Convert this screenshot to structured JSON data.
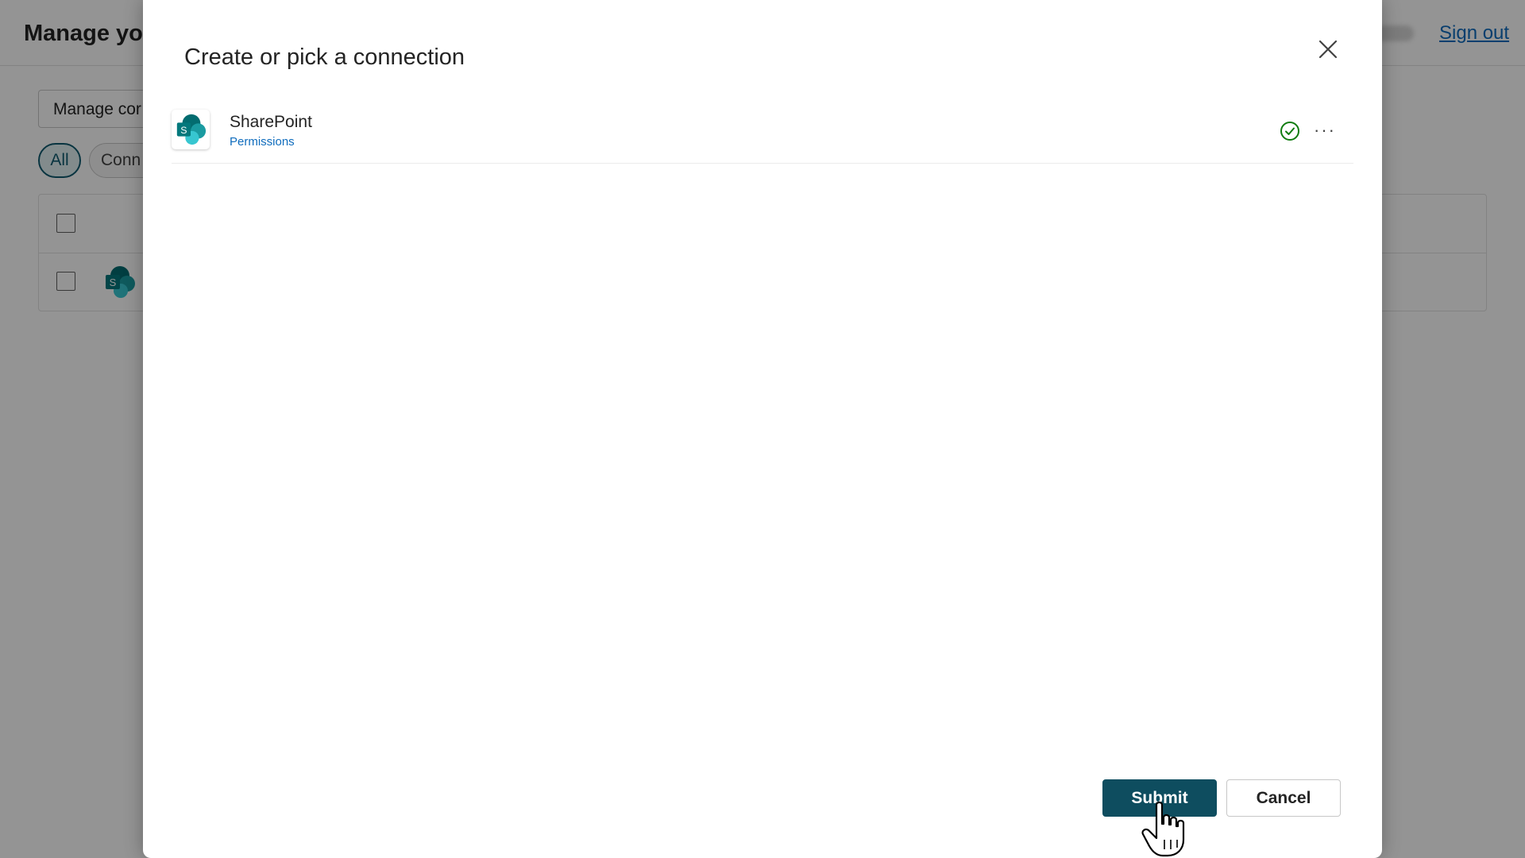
{
  "background": {
    "page_title": "Manage you",
    "sign_out": "Sign out",
    "manage_button_label": "Manage cor",
    "filter_all": "All",
    "filter_connections": "Conn"
  },
  "dialog": {
    "title": "Create or pick a connection",
    "connection": {
      "name": "SharePoint",
      "link_label": "Permissions",
      "icon": "sharepoint-icon",
      "status": "connected",
      "status_color": "#107c10",
      "more_label": "···"
    },
    "submit_label": "Submit",
    "cancel_label": "Cancel"
  },
  "colors": {
    "accent": "#0e4d5f",
    "link": "#0f6cbd",
    "sharepoint_dark": "#036c70",
    "sharepoint_mid": "#1a9ba1",
    "sharepoint_light": "#37c6d0"
  }
}
